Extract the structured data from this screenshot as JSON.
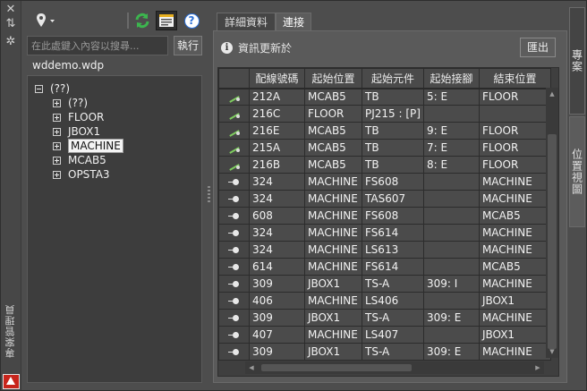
{
  "left_strip": {
    "close_icon": "close-icon",
    "autohide_icon": "autohide-icon",
    "settings_icon": "settings-icon",
    "vertical_title": "專案管理員"
  },
  "toolbar": {
    "location_icon": "location-pin-icon",
    "refresh_icon": "refresh-icon",
    "report_icon": "report-icon",
    "help_icon": "help-icon",
    "help_glyph": "?"
  },
  "search": {
    "placeholder": "在此處鍵入內容以搜尋...",
    "value": "",
    "exec_label": "執行"
  },
  "project": {
    "name": "wddemo.wdp"
  },
  "tree": {
    "root": "(??)",
    "children": [
      "(??)",
      "FLOOR",
      "JBOX1",
      "MACHINE",
      "MCAB5",
      "OPSTA3"
    ],
    "selected": "MACHINE"
  },
  "tabs": [
    {
      "label": "詳細資料"
    },
    {
      "label": "連接"
    }
  ],
  "active_tab": "連接",
  "info": {
    "text": "資訊更新於",
    "export_label": "匯出"
  },
  "grid": {
    "columns": [
      "",
      "配線號碼",
      "起始位置",
      "起始元件",
      "起始接腳",
      "結束位置"
    ],
    "rows": [
      {
        "icon": "wire",
        "cells": [
          "212A",
          "MCAB5",
          "TB",
          "5: E",
          "FLOOR"
        ]
      },
      {
        "icon": "wire",
        "cells": [
          "216C",
          "FLOOR",
          "PJ215 : [P]",
          "",
          ""
        ]
      },
      {
        "icon": "wire",
        "cells": [
          "216E",
          "MCAB5",
          "TB",
          "9: E",
          "FLOOR"
        ]
      },
      {
        "icon": "wire",
        "cells": [
          "215A",
          "MCAB5",
          "TB",
          "7: E",
          "FLOOR"
        ]
      },
      {
        "icon": "wire",
        "cells": [
          "216B",
          "MCAB5",
          "TB",
          "8: E",
          "FLOOR"
        ]
      },
      {
        "icon": "dot",
        "cells": [
          "324",
          "MACHINE",
          "FS608",
          "",
          "MACHINE"
        ]
      },
      {
        "icon": "dot",
        "cells": [
          "324",
          "MACHINE",
          "TAS607",
          "",
          "MACHINE"
        ]
      },
      {
        "icon": "dot",
        "cells": [
          "608",
          "MACHINE",
          "FS608",
          "",
          "MCAB5"
        ]
      },
      {
        "icon": "dot",
        "cells": [
          "324",
          "MACHINE",
          "FS614",
          "",
          "MACHINE"
        ]
      },
      {
        "icon": "dot",
        "cells": [
          "324",
          "MACHINE",
          "LS613",
          "",
          "MACHINE"
        ]
      },
      {
        "icon": "dot",
        "cells": [
          "614",
          "MACHINE",
          "FS614",
          "",
          "MCAB5"
        ]
      },
      {
        "icon": "dot",
        "cells": [
          "309",
          "JBOX1",
          "TS-A",
          "309: I",
          "MACHINE"
        ]
      },
      {
        "icon": "dot",
        "cells": [
          "406",
          "MACHINE",
          "LS406",
          "",
          "JBOX1"
        ]
      },
      {
        "icon": "dot",
        "cells": [
          "309",
          "JBOX1",
          "TS-A",
          "309: E",
          "MACHINE"
        ]
      },
      {
        "icon": "dot",
        "cells": [
          "407",
          "MACHINE",
          "LS407",
          "",
          "JBOX1"
        ]
      },
      {
        "icon": "dot",
        "cells": [
          "309",
          "JBOX1",
          "TS-A",
          "309: E",
          "MACHINE"
        ]
      }
    ]
  },
  "side_tabs": [
    {
      "label": "專案"
    },
    {
      "label": "位置視圖"
    }
  ],
  "colors": {
    "background": "#4d4d4d",
    "panel": "#3d3d3d",
    "refresh_green": "#2ea84a",
    "help_blue": "#2a6fd8",
    "logo_red": "#c8251c"
  }
}
